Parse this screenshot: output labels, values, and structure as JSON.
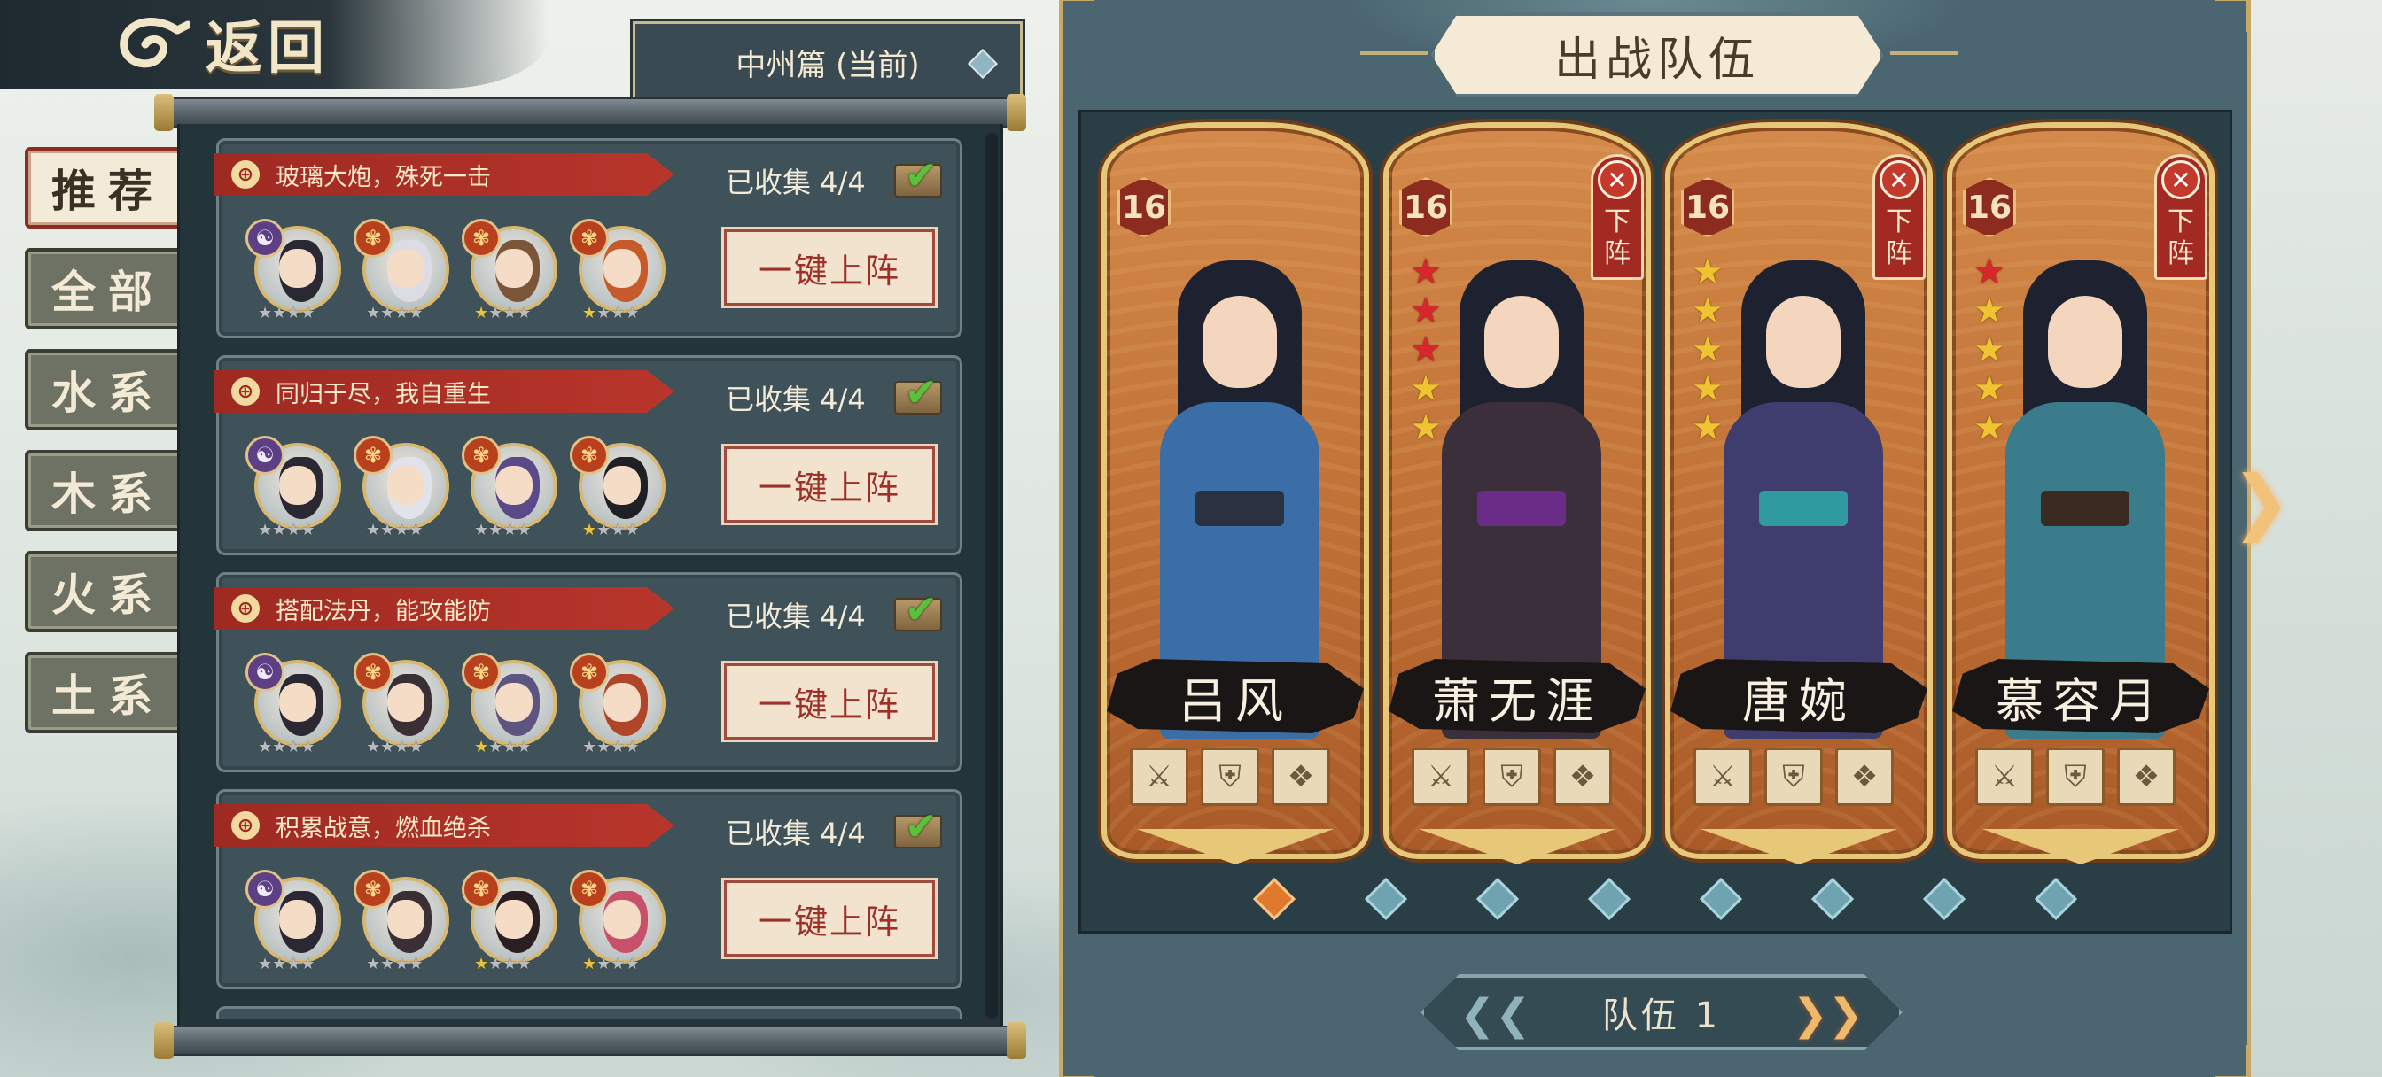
{
  "back": {
    "label": "返回"
  },
  "chapter": {
    "label": "中州篇 (当前)"
  },
  "tabs": [
    {
      "label": "推荐",
      "active": true
    },
    {
      "label": "全部",
      "active": false
    },
    {
      "label": "水系",
      "active": false
    },
    {
      "label": "木系",
      "active": false
    },
    {
      "label": "火系",
      "active": false
    },
    {
      "label": "土系",
      "active": false
    }
  ],
  "lineups": [
    {
      "tag": "玻璃大炮，殊死一击",
      "collected": "已收集 4/4",
      "button": "一键上阵",
      "heroes": [
        {
          "element": "yinyang",
          "gold_stars": 0,
          "hair": "#2a2833"
        },
        {
          "element": "fire",
          "gold_stars": 0,
          "hair": "#dcdce4"
        },
        {
          "element": "fire",
          "gold_stars": 1,
          "hair": "#7a5538"
        },
        {
          "element": "fire",
          "gold_stars": 1,
          "hair": "#c65a2a"
        }
      ]
    },
    {
      "tag": "同归于尽，我自重生",
      "collected": "已收集 4/4",
      "button": "一键上阵",
      "heroes": [
        {
          "element": "yinyang",
          "gold_stars": 0,
          "hair": "#2a2833"
        },
        {
          "element": "fire",
          "gold_stars": 0,
          "hair": "#e2e2ea"
        },
        {
          "element": "fire",
          "gold_stars": 0,
          "hair": "#5b4a8a"
        },
        {
          "element": "fire",
          "gold_stars": 1,
          "hair": "#1f1f26"
        }
      ]
    },
    {
      "tag": "搭配法丹，能攻能防",
      "collected": "已收集 4/4",
      "button": "一键上阵",
      "heroes": [
        {
          "element": "yinyang",
          "gold_stars": 0,
          "hair": "#2a2833"
        },
        {
          "element": "fire",
          "gold_stars": 0,
          "hair": "#3a2f35"
        },
        {
          "element": "fire",
          "gold_stars": 1,
          "hair": "#5d5580"
        },
        {
          "element": "fire",
          "gold_stars": 0,
          "hair": "#b0452a"
        }
      ]
    },
    {
      "tag": "积累战意，燃血绝杀",
      "collected": "已收集 4/4",
      "button": "一键上阵",
      "heroes": [
        {
          "element": "yinyang",
          "gold_stars": 0,
          "hair": "#2a2833"
        },
        {
          "element": "fire",
          "gold_stars": 0,
          "hair": "#3a2f35"
        },
        {
          "element": "fire",
          "gold_stars": 1,
          "hair": "#2b1e22"
        },
        {
          "element": "fire",
          "gold_stars": 1,
          "hair": "#c9506a"
        }
      ]
    }
  ],
  "element_icons": {
    "yinyang": "yinyang-icon",
    "fire": "flame-icon"
  },
  "team_panel": {
    "title": "出战队伍",
    "team_label": "队伍 1",
    "remove_label": "下阵",
    "page_count": 8,
    "active_page": 0,
    "heroes": [
      {
        "name": "吕风",
        "level": "16",
        "red_stars": 0,
        "gold_stars": 0,
        "removable": false,
        "robe": "#3b6ea6",
        "sash": "#2a3242",
        "equipment": [
          "weapon-icon",
          "armor-icon",
          "accessory-icon"
        ]
      },
      {
        "name": "萧无涯",
        "level": "16",
        "red_stars": 3,
        "gold_stars": 2,
        "removable": true,
        "robe": "#3a2f3a",
        "sash": "#6a2c86",
        "equipment": [
          "weapon-icon",
          "armor-icon",
          "accessory-icon"
        ]
      },
      {
        "name": "唐婉",
        "level": "16",
        "red_stars": 0,
        "gold_stars": 5,
        "removable": true,
        "robe": "#3f3d6e",
        "sash": "#2f9aa0",
        "equipment": [
          "weapon-icon",
          "armor-icon",
          "accessory-icon"
        ]
      },
      {
        "name": "慕容月",
        "level": "16",
        "red_stars": 1,
        "gold_stars": 4,
        "removable": true,
        "robe": "#3a7c8c",
        "sash": "#3a2a22",
        "equipment": [
          "weapon-icon",
          "armor-icon",
          "accessory-icon"
        ]
      }
    ]
  },
  "colors": {
    "accent_red": "#9e2a22",
    "gold": "#e7c878",
    "panel_teal": "#4b6670",
    "active_page": "#e0782e"
  }
}
